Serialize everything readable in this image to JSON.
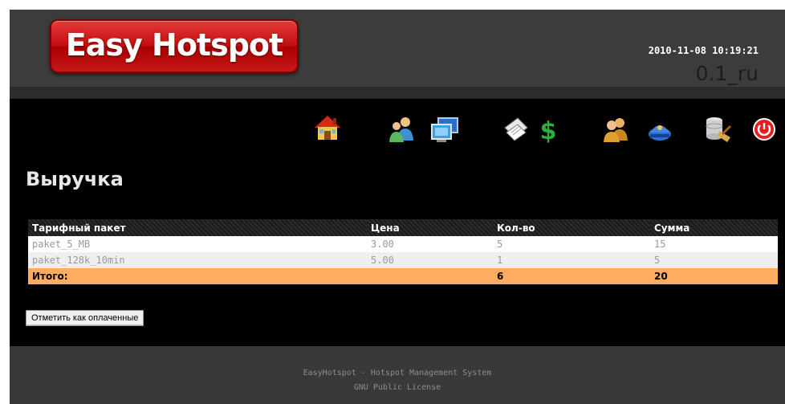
{
  "header": {
    "logo_text": "Easy Hotspot",
    "datetime": "2010-11-08 10:19:21",
    "version": "0.1_ru"
  },
  "nav_icons": [
    {
      "name": "home-icon"
    },
    {
      "name": "users-icon"
    },
    {
      "name": "computers-icon"
    },
    {
      "name": "tickets-icon"
    },
    {
      "name": "money-icon"
    },
    {
      "name": "admins-icon"
    },
    {
      "name": "police-icon"
    },
    {
      "name": "database-clean-icon"
    },
    {
      "name": "power-icon"
    }
  ],
  "main": {
    "title": "Выручка",
    "table": {
      "headers": [
        "Тарифный пакет",
        "Цена",
        "Кол-во",
        "Сумма"
      ],
      "rows": [
        [
          "paket_5_MB",
          "3.00",
          "5",
          "15"
        ],
        [
          "paket_128k_10min",
          "5.00",
          "1",
          "5"
        ]
      ],
      "total": {
        "label": "Итого:",
        "price": "",
        "qty": "6",
        "sum": "20"
      }
    },
    "mark_paid_button": "Отметить как оплаченные"
  },
  "footer": {
    "line1": "EasyHotspot - Hotspot Management System",
    "line2": "GNU Public License"
  },
  "colors": {
    "logo_red": "#c40f0f",
    "total_row": "#ffac60",
    "main_bg": "#000000",
    "frame_bg": "#3a3a3a"
  }
}
